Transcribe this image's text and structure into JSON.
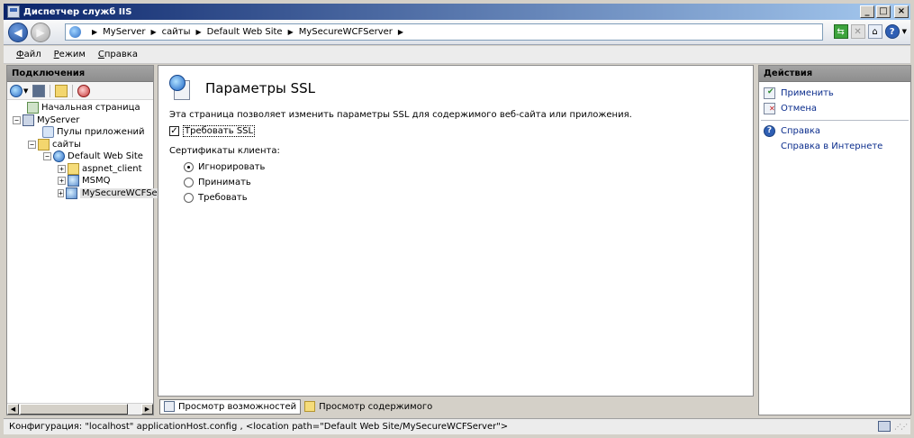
{
  "window": {
    "title": "Диспетчер служб IIS",
    "buttons": {
      "minimize": "_",
      "maximize": "□",
      "close": "×"
    }
  },
  "navigation": {
    "breadcrumbs": [
      "MyServer",
      "сайты",
      "Default Web Site",
      "MySecureWCFServer"
    ],
    "separator": "▶"
  },
  "menu": {
    "items": [
      {
        "label": "Файл",
        "accel": "Ф",
        "rest": "айл"
      },
      {
        "label": "Режим",
        "accel": "Р",
        "rest": "ежим"
      },
      {
        "label": "Справка",
        "accel": "С",
        "rest": "правка"
      }
    ]
  },
  "connections": {
    "header": "Подключения",
    "tree": [
      {
        "label": "Начальная страница",
        "icon": "home-icon",
        "level": 0,
        "expander": ""
      },
      {
        "label": "MyServer",
        "icon": "server-icon",
        "level": 0,
        "expander": "−"
      },
      {
        "label": "Пулы приложений",
        "icon": "app-pool-icon",
        "level": 1,
        "expander": ""
      },
      {
        "label": "сайты",
        "icon": "sites-icon",
        "level": 1,
        "expander": "−"
      },
      {
        "label": "Default Web Site",
        "icon": "website-globe-icon",
        "level": 2,
        "expander": "−"
      },
      {
        "label": "aspnet_client",
        "icon": "folder-icon",
        "level": 3,
        "expander": "+"
      },
      {
        "label": "MSMQ",
        "icon": "application-icon",
        "level": 3,
        "expander": "+"
      },
      {
        "label": "MySecureWCFServ",
        "icon": "application-icon",
        "level": 3,
        "expander": "+",
        "selected": true
      }
    ]
  },
  "feature": {
    "title": "Параметры SSL",
    "description": "Эта страница позволяет изменить параметры SSL для содержимого веб-сайта или приложения.",
    "require_ssl": {
      "label": "Требовать SSL",
      "checked": true
    },
    "client_certs_label": "Сертификаты клиента:",
    "client_cert_options": [
      {
        "label": "Игнорировать",
        "selected": true
      },
      {
        "label": "Принимать",
        "selected": false
      },
      {
        "label": "Требовать",
        "selected": false
      }
    ]
  },
  "view_tabs": {
    "features": "Просмотр возможностей",
    "content": "Просмотр содержимого",
    "active": "features"
  },
  "actions": {
    "header": "Действия",
    "items": [
      {
        "label": "Применить",
        "icon": "apply-icon"
      },
      {
        "label": "Отмена",
        "icon": "cancel-icon"
      }
    ],
    "help_items": [
      {
        "label": "Справка",
        "icon": "help-icon"
      },
      {
        "label": "Справка в Интернете",
        "icon": ""
      }
    ]
  },
  "status": {
    "text": "Конфигурация: \"localhost\" applicationHost.config , <location path=\"Default Web Site/MySecureWCFServer\">"
  },
  "colors": {
    "title_bar": "#0a246a",
    "panel_header": "#9a9a9a",
    "link": "#0a2c8c"
  }
}
